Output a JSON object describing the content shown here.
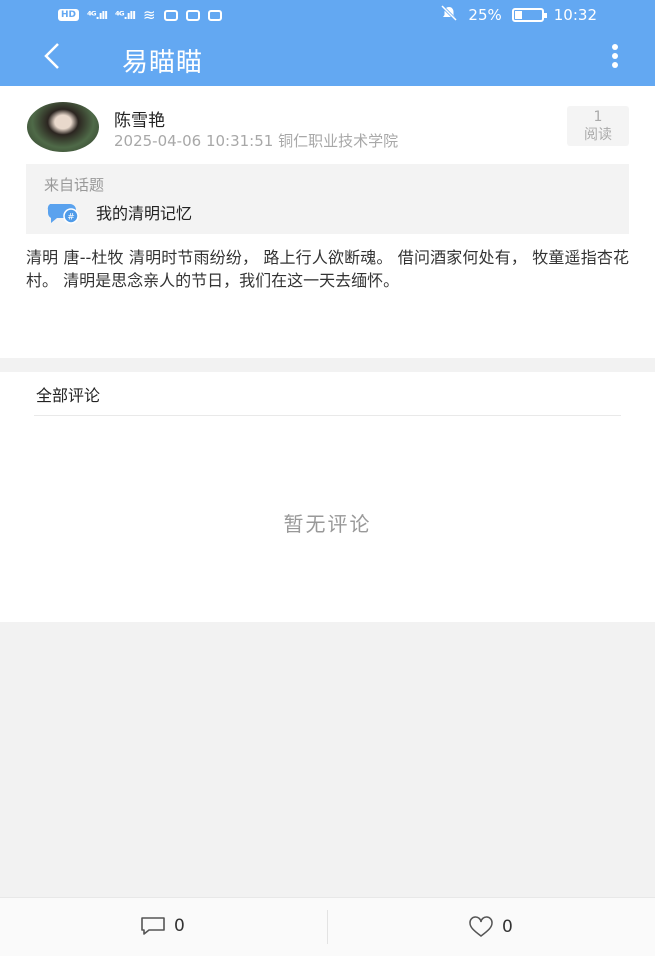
{
  "statusbar": {
    "badge": "HD",
    "signal1": "⁴ᴳ.ıll",
    "signal2": "⁴ᴳ.ıll",
    "mute_icon": "bell-off-icon",
    "battery_pct": "25%",
    "battery_level": 0.25,
    "time": "10:32"
  },
  "appbar": {
    "back_glyph": "<",
    "title": "易瞄瞄"
  },
  "post": {
    "author": "陈雪艳",
    "meta": "2025-04-06 10:31:51 铜仁职业技术学院",
    "reads_count": "1",
    "reads_label": "阅读",
    "topic_header": "来自话题",
    "topic_name": "我的清明记忆",
    "content": "清明 唐--杜牧 清明时节雨纷纷， 路上行人欲断魂。 借问酒家何处有， 牧童遥指杏花村。 清明是思念亲人的节日，我们在这一天去缅怀。"
  },
  "comments": {
    "header": "全部评论",
    "empty_text": "暂无评论"
  },
  "bottombar": {
    "comment_count": "0",
    "like_count": "0"
  },
  "colors": {
    "accent": "#63a8f2",
    "topic_icon": "#5aa2ee"
  }
}
